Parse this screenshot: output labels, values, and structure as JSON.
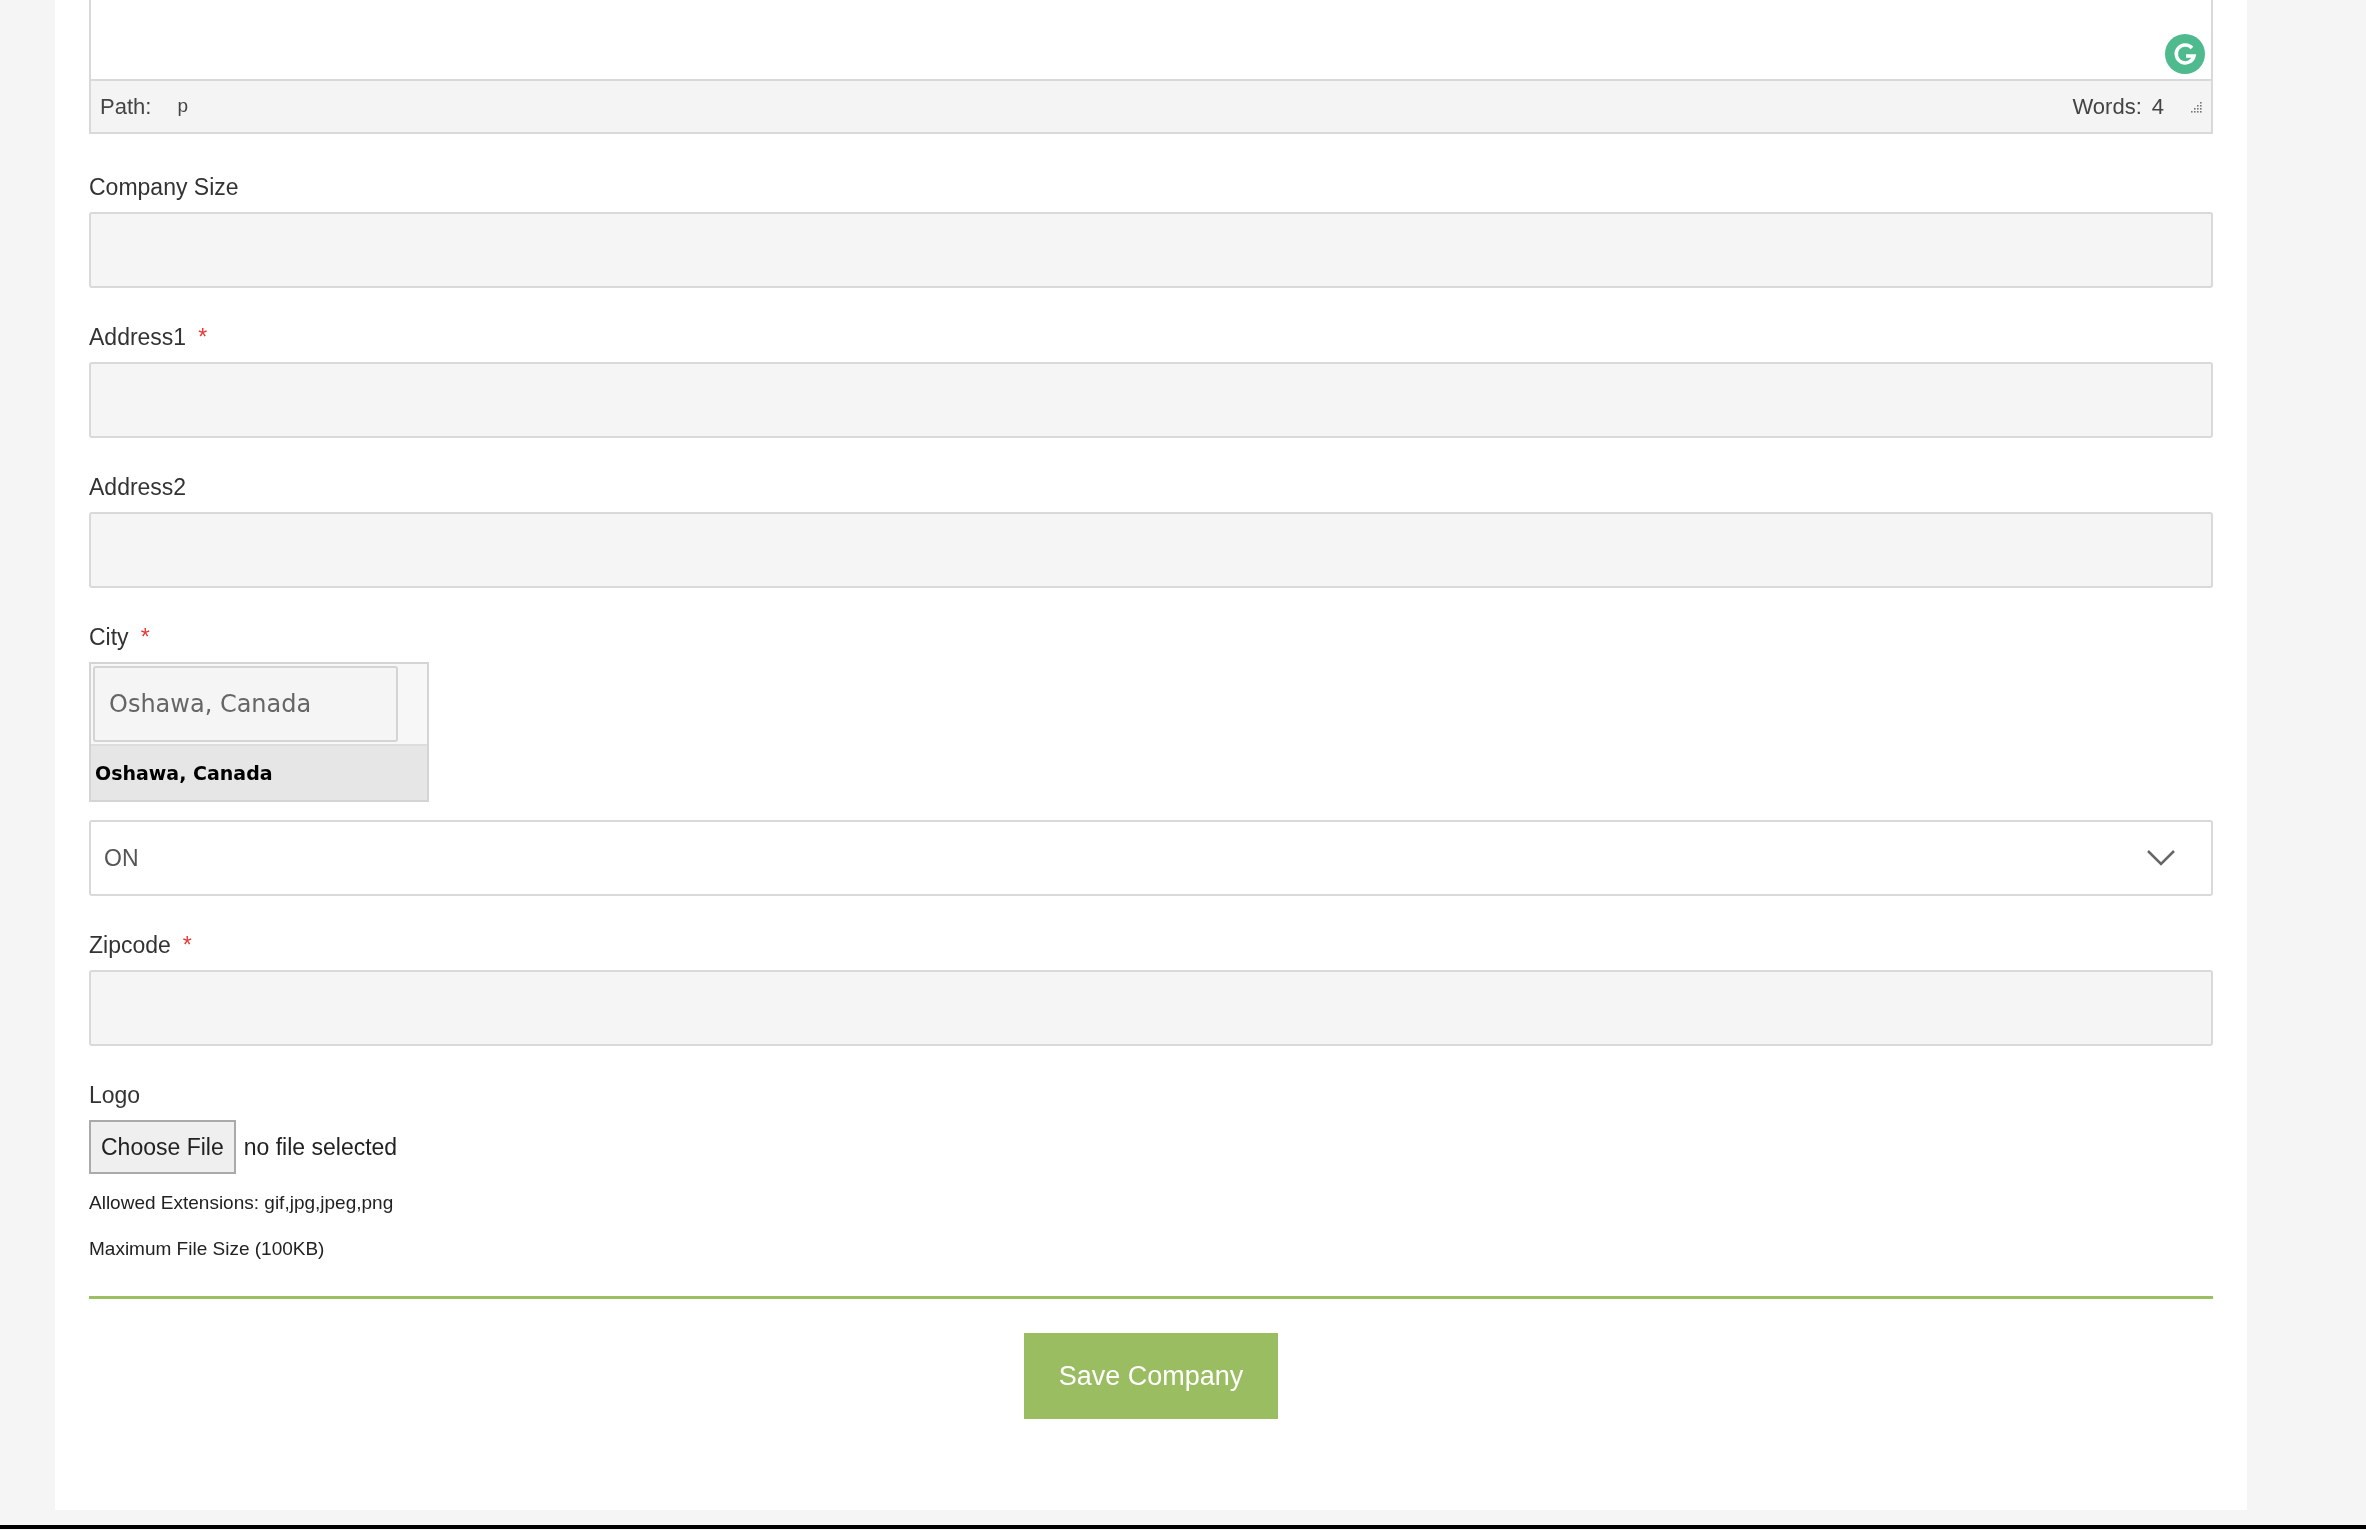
{
  "editor": {
    "path_label": "Path:",
    "path": "p",
    "words_label": "Words:",
    "word_count": "4"
  },
  "fields": [
    {
      "kind": "text",
      "label": "Company Size"
    },
    {
      "kind": "text",
      "label": "Address1",
      "required_mark": "*"
    },
    {
      "kind": "text",
      "label": "Address2"
    },
    {
      "kind": "city",
      "label": "City",
      "required_mark": "*",
      "value": "Oshawa, Canada",
      "suggestions": [
        "Oshawa, Canada"
      ]
    },
    {
      "kind": "select",
      "value": "ON"
    },
    {
      "kind": "text",
      "label": "Zipcode",
      "required_mark": "*"
    },
    {
      "kind": "file",
      "label": "Logo",
      "button": "Choose File",
      "status": "no file selected",
      "notes": [
        "Allowed Extensions: gif,jpg,jpeg,png",
        "Maximum File Size (100KB)"
      ]
    }
  ],
  "submit": "Save Company"
}
